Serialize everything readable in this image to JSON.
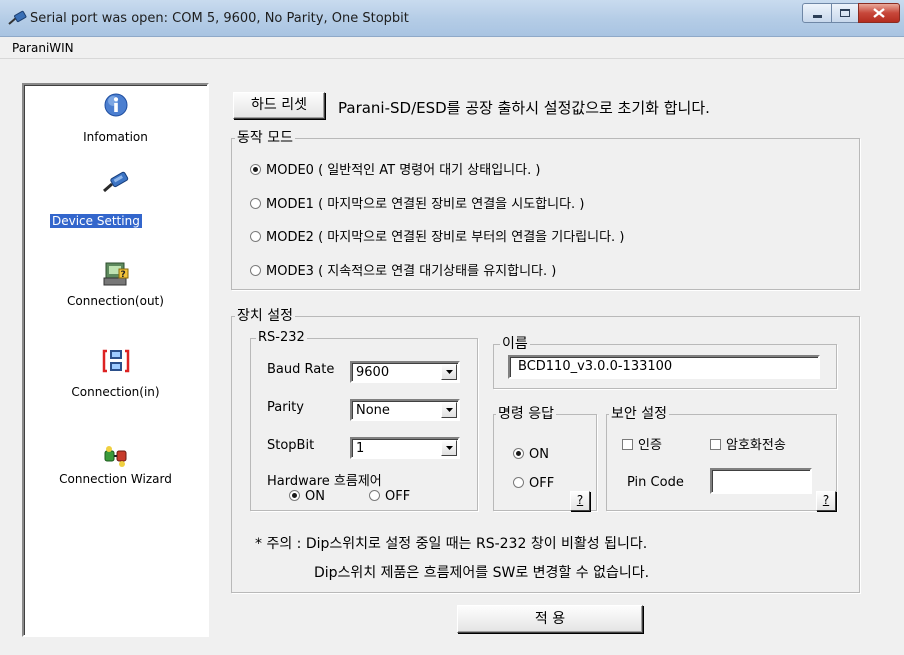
{
  "window": {
    "title": "Serial port was open: COM 5, 9600, No Parity, One Stopbit"
  },
  "menu": {
    "items": [
      "ParaniWIN"
    ]
  },
  "sidebar": {
    "items": [
      {
        "label": "Infomation",
        "icon": "info-icon"
      },
      {
        "label": "Device Setting",
        "icon": "serial-plug-icon",
        "selected": true
      },
      {
        "label": "Connection(out)",
        "icon": "connection-out-icon"
      },
      {
        "label": "Connection(in)",
        "icon": "connection-in-icon"
      },
      {
        "label": "Connection Wizard",
        "icon": "connection-wizard-icon"
      }
    ]
  },
  "hard_reset": {
    "button_label": "하드 리셋",
    "description": "Parani-SD/ESD를 공장 출하시 설정값으로 초기화 합니다."
  },
  "operation_mode": {
    "title": "동작 모드",
    "options": [
      {
        "label": "MODE0 ( 일반적인 AT 명령어 대기 상태입니다. )",
        "checked": true
      },
      {
        "label": "MODE1 ( 마지막으로 연결된 장비로 연결을 시도합니다. )",
        "checked": false
      },
      {
        "label": "MODE2 ( 마지막으로 연결된 장비로 부터의 연결을 기다립니다. )",
        "checked": false
      },
      {
        "label": "MODE3 ( 지속적으로 연결 대기상태를 유지합니다. )",
        "checked": false
      }
    ]
  },
  "device_settings": {
    "title": "장치 설정",
    "rs232": {
      "title": "RS-232",
      "baud_rate_label": "Baud Rate",
      "baud_rate_value": "9600",
      "parity_label": "Parity",
      "parity_value": "None",
      "stopbit_label": "StopBit",
      "stopbit_value": "1",
      "flow_control_label": "Hardware 흐름제어",
      "flow_on_label": "ON",
      "flow_off_label": "OFF",
      "flow_control": "ON"
    },
    "name": {
      "title": "이름",
      "value": "BCD110_v3.0.0-133100"
    },
    "command_response": {
      "title": "명령 응답",
      "on_label": "ON",
      "off_label": "OFF",
      "selected": "ON",
      "help_label": "?"
    },
    "security": {
      "title": "보안 설정",
      "auth_label": "인증",
      "auth_checked": false,
      "encrypt_label": "암호화전송",
      "encrypt_checked": false,
      "pin_code_label": "Pin Code",
      "pin_code_value": "",
      "help_label": "?"
    },
    "note_line1": "* 주의 : Dip스위치로 설정 중일 때는 RS-232 창이 비활성 됩니다.",
    "note_line2": "Dip스위치 제품은 흐름제어를  SW로 변경할 수 없습니다."
  },
  "apply_button": "적 용"
}
